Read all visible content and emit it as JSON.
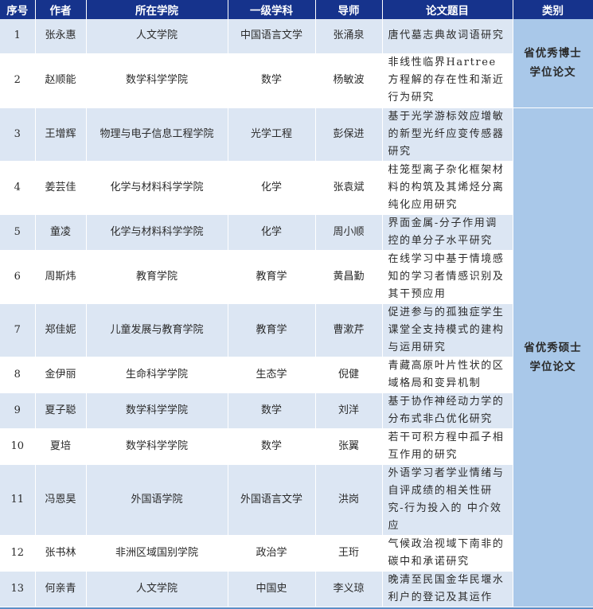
{
  "headers": [
    "序号",
    "作者",
    "所在学院",
    "一级学科",
    "导师",
    "论文题目",
    "类别"
  ],
  "categories": {
    "doctor": "省优秀博士学位论文",
    "master": "省优秀硕士学位论文"
  },
  "rows": [
    {
      "no": "1",
      "author": "张永惠",
      "college": "人文学院",
      "discipline": "中国语言文学",
      "advisor": "张涌泉",
      "title": "唐代墓志典故词语研究"
    },
    {
      "no": "2",
      "author": "赵顺能",
      "college": "数学科学学院",
      "discipline": "数学",
      "advisor": "杨敏波",
      "title": "非线性临界Hartree方程解的存在性和渐近行为研究"
    },
    {
      "no": "3",
      "author": "王增辉",
      "college": "物理与电子信息工程学院",
      "discipline": "光学工程",
      "advisor": "彭保进",
      "title": "基于光学游标效应增敏的新型光纤应变传感器研究"
    },
    {
      "no": "4",
      "author": "姜芸佳",
      "college": "化学与材料科学学院",
      "discipline": "化学",
      "advisor": "张袁斌",
      "title": "柱笼型离子杂化框架材料的构筑及其烯烃分离纯化应用研究"
    },
    {
      "no": "5",
      "author": "童凌",
      "college": "化学与材料科学学院",
      "discipline": "化学",
      "advisor": "周小顺",
      "title": "界面金属-分子作用调控的单分子水平研究"
    },
    {
      "no": "6",
      "author": "周斯炜",
      "college": "教育学院",
      "discipline": "教育学",
      "advisor": "黄昌勤",
      "title": "在线学习中基于情境感知的学习者情感识别及其干预应用"
    },
    {
      "no": "7",
      "author": "郑佳妮",
      "college": "儿童发展与教育学院",
      "discipline": "教育学",
      "advisor": "曹漱芹",
      "title": "促进参与的孤独症学生课堂全支持模式的建构与运用研究"
    },
    {
      "no": "8",
      "author": "金伊丽",
      "college": "生命科学学院",
      "discipline": "生态学",
      "advisor": "倪健",
      "title": "青藏高原叶片性状的区域格局和变异机制"
    },
    {
      "no": "9",
      "author": "夏子聪",
      "college": "数学科学学院",
      "discipline": "数学",
      "advisor": "刘洋",
      "title": "基于协作神经动力学的分布式非凸优化研究"
    },
    {
      "no": "10",
      "author": "夏培",
      "college": "数学科学学院",
      "discipline": "数学",
      "advisor": "张翼",
      "title": "若干可积方程中孤子相互作用的研究"
    },
    {
      "no": "11",
      "author": "冯恩昊",
      "college": "外国语学院",
      "discipline": "外国语言文学",
      "advisor": "洪岗",
      "title": "外语学习者学业情绪与自评成绩的相关性研究-行为投入的 中介效应"
    },
    {
      "no": "12",
      "author": "张书林",
      "college": "非洲区域国别学院",
      "discipline": "政治学",
      "advisor": "王珩",
      "title": "气候政治视域下南非的碳中和承诺研究"
    },
    {
      "no": "13",
      "author": "何亲青",
      "college": "人文学院",
      "discipline": "中国史",
      "advisor": "李义琼",
      "title": "晚清至民国金华民堰水利户的登记及其运作"
    }
  ],
  "colors": {
    "header_bg": "#16338c",
    "row_shade": "#dce6f3",
    "category_bg": "#a9c8e9"
  }
}
